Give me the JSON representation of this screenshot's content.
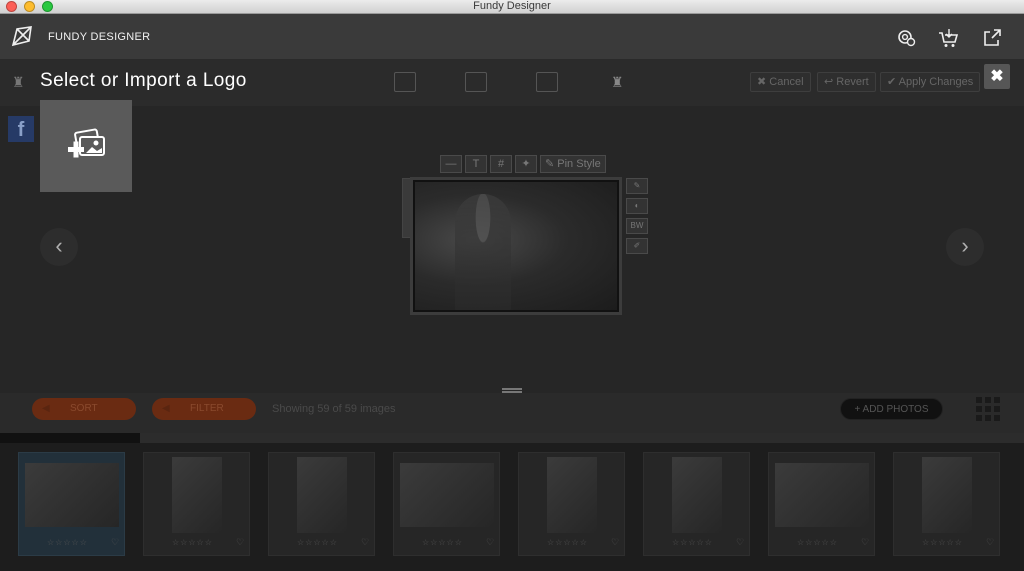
{
  "window": {
    "title": "Fundy Designer"
  },
  "app": {
    "name": "FUNDY DESIGNER",
    "header_icons": [
      "settings-gear-icon",
      "cart-icon",
      "external-link-icon"
    ]
  },
  "dialog": {
    "title": "Select or Import a Logo",
    "import_tile_icon": "import-photos-icon",
    "close_label": "✖"
  },
  "actions": {
    "cancel": "Cancel",
    "revert": "Revert",
    "apply": "Apply Changes"
  },
  "frame_tools": {
    "pin_style": "Pin Style",
    "text_tool": "T",
    "grid_tool": "#",
    "minus_tool": "—",
    "ruler_label": "|"
  },
  "side_tools": {
    "bw": "BW"
  },
  "social": {
    "facebook_label": "f"
  },
  "bottom": {
    "sort_label": "SORT",
    "filter_label": "FILTER",
    "showing": "Showing 59 of 59 images",
    "add_photos": "+ ADD PHOTOS",
    "progress_fraction": 0.137
  },
  "thumbnails": [
    {
      "rating": "☆☆☆☆☆",
      "favorite": "♡",
      "orientation": "landscape",
      "selected": true
    },
    {
      "rating": "☆☆☆☆☆",
      "favorite": "♡",
      "orientation": "portrait",
      "selected": false
    },
    {
      "rating": "☆☆☆☆☆",
      "favorite": "♡",
      "orientation": "portrait",
      "selected": false
    },
    {
      "rating": "☆☆☆☆☆",
      "favorite": "♡",
      "orientation": "landscape",
      "selected": false
    },
    {
      "rating": "☆☆☆☆☆",
      "favorite": "♡",
      "orientation": "portrait",
      "selected": false
    },
    {
      "rating": "☆☆☆☆☆",
      "favorite": "♡",
      "orientation": "portrait",
      "selected": false
    },
    {
      "rating": "☆☆☆☆☆",
      "favorite": "♡",
      "orientation": "landscape",
      "selected": false
    },
    {
      "rating": "☆☆☆☆☆",
      "favorite": "♡",
      "orientation": "portrait",
      "selected": false
    }
  ],
  "nav": {
    "prev": "‹",
    "next": "›"
  }
}
